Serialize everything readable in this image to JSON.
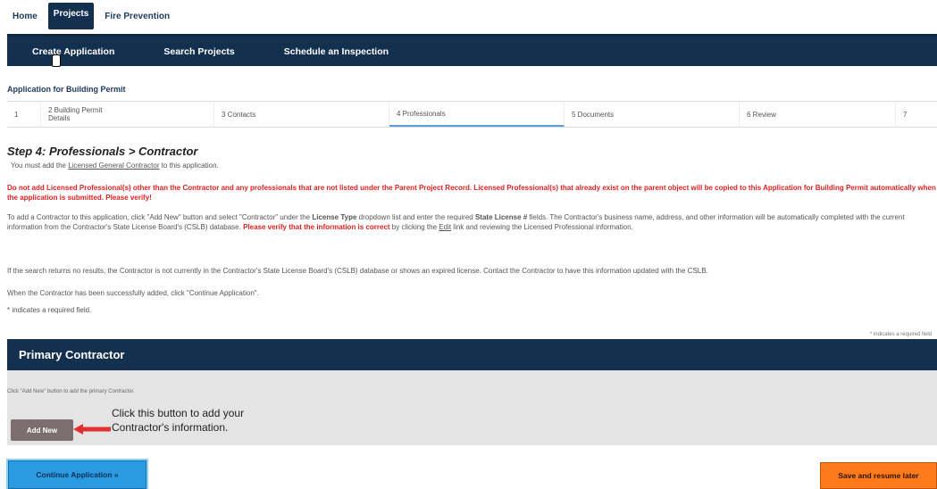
{
  "top_tabs": [
    {
      "label": "Home"
    },
    {
      "label": "Projects"
    },
    {
      "label": "Fire Prevention"
    }
  ],
  "nav": [
    {
      "label": "Create Application"
    },
    {
      "label": "Search Projects"
    },
    {
      "label": "Schedule an Inspection"
    }
  ],
  "app_title": "Application for Building Permit",
  "steps": [
    {
      "label": "1"
    },
    {
      "label": "2 Building Permit Details"
    },
    {
      "label": "3 Contacts"
    },
    {
      "label": "4 Professionals"
    },
    {
      "label": "5 Documents"
    },
    {
      "label": "6 Review"
    },
    {
      "label": "7"
    }
  ],
  "step_heading": "Step 4: Professionals > Contractor",
  "step_sub": {
    "before": "You must add the ",
    "link": "Licensed General Contractor",
    "after": " to this application."
  },
  "warning": "Do not add Licensed Professional(s) other than the Contractor and any professionals that are not listed under the Parent Project Record. Licensed Professional(s) that already exist on the parent object will be copied to this Application for Building Permit automatically when the application is submitted. Please verify!",
  "para1": {
    "a": "To add a Contractor to this application, click \"Add New\" button and select \"Contractor\" under the ",
    "b": "License Type",
    "c": " dropdown list and enter the required ",
    "d": "State License #",
    "e": " fields. The Contractor's business name, address, and other information will be automatically completed with the current information from the Contractor's State License Board's (CSLB) database. ",
    "f": "Please verify that the information is correct",
    "g": " by clicking the ",
    "h": "Edit",
    "i": " link and reviewing the Licensed Professional information."
  },
  "para2": "If the search returns no results, the Contractor is not currently in the Contractor's State License Board's (CSLB) database or shows an expired license. Contact the Contractor to have this information updated with the CSLB.",
  "para3": "When the Contractor has been successfully added, click \"Continue Application\".",
  "req_note": "* indicates a required field.",
  "req_note_right": "* indicates a required field",
  "section": {
    "title": "Primary Contractor",
    "hint": "Click \"Add New\" button to add the primary Contractor.",
    "add_new": "Add New",
    "callout_line1": "Click this button to add your",
    "callout_line2": "Contractor's information."
  },
  "buttons": {
    "continue": "Continue Application »",
    "save": "Save and resume later"
  },
  "colors": {
    "nav_bg": "#14304f",
    "warning": "#e02020",
    "continue_bg": "#2a9be0",
    "save_bg": "#ff7a1a",
    "arrow": "#e03030"
  }
}
